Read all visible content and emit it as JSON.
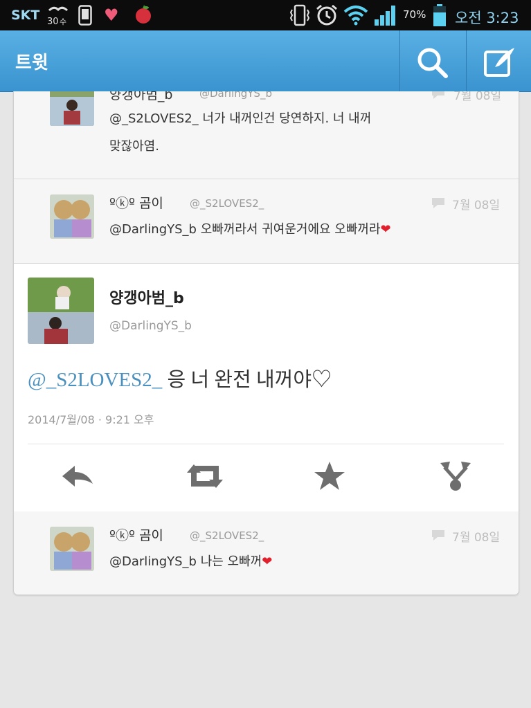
{
  "status_bar": {
    "carrier": "SKT",
    "temperature": "30",
    "battery_percent": "70%",
    "time": "오전 3:23",
    "icons": [
      "temperature-icon",
      "phone-icon",
      "heart-icon",
      "apple-icon",
      "vibrate-icon",
      "alarm-icon",
      "wifi-icon",
      "signal-icon",
      "battery-icon"
    ]
  },
  "action_bar": {
    "title": "트윗",
    "icons": [
      "search-icon",
      "compose-icon"
    ],
    "accent_color": "#3a93cf"
  },
  "replies_above": [
    {
      "name": "양갱아범_b",
      "handle": "@DarlingYS_b",
      "date": "7월 08일",
      "text_line1": "@_S2LOVES2_ 너가 내꺼인건 당연하지. 너 내꺼",
      "text_line2": "맞잖아염."
    },
    {
      "name": "ºⓚº 곰이",
      "handle": "@_S2LOVES2_",
      "date": "7월 08일",
      "text": "@DarlingYS_b 오빠꺼라서 귀여운거에요 오빠꺼라",
      "emoji": "❤"
    }
  ],
  "main_tweet": {
    "name": "양갱아범_b",
    "handle": "@DarlingYS_b",
    "mention": "@_S2LOVES2_",
    "text": " 응 너 완전 내꺼야♡",
    "timestamp": "2014/7월/08 · 9:21 오후",
    "actions": [
      "reply-icon",
      "retweet-icon",
      "favorite-icon",
      "share-icon"
    ]
  },
  "replies_below": [
    {
      "name": "ºⓚº 곰이",
      "handle": "@_S2LOVES2_",
      "date": "7월 08일",
      "text": "@DarlingYS_b 나는 오빠꺼",
      "emoji": "❤"
    }
  ]
}
